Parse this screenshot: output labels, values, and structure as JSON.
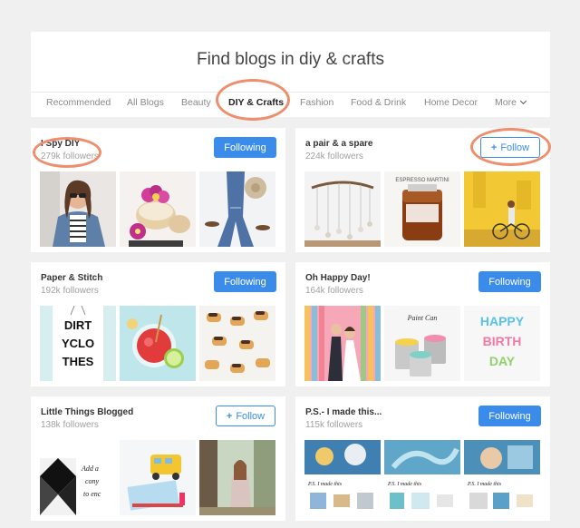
{
  "header": {
    "title": "Find blogs in diy & crafts",
    "tabs": [
      {
        "label": "Recommended"
      },
      {
        "label": "All Blogs"
      },
      {
        "label": "Beauty"
      },
      {
        "label": "DIY & Crafts"
      },
      {
        "label": "Fashion"
      },
      {
        "label": "Food & Drink"
      },
      {
        "label": "Home Decor"
      },
      {
        "label": "More"
      }
    ]
  },
  "blogs": [
    {
      "name": "I Spy DIY",
      "followers": "279k followers",
      "button": "Following"
    },
    {
      "name": "a pair & a spare",
      "followers": "224k followers",
      "button": "Follow"
    },
    {
      "name": "Paper & Stitch",
      "followers": "192k followers",
      "button": "Following"
    },
    {
      "name": "Oh Happy Day!",
      "followers": "164k followers",
      "button": "Following"
    },
    {
      "name": "Little Things Blogged",
      "followers": "138k followers",
      "button": "Follow"
    },
    {
      "name": "P.S.- I made this...",
      "followers": "115k followers",
      "button": "Following"
    }
  ],
  "thumbs": {
    "tshirt": [
      "DIRT",
      "YCLO",
      "THES"
    ],
    "birthday": [
      "HAPPY",
      "BIRTH",
      "DAY"
    ],
    "bottle": "ESPRESSO MARTINI",
    "can": "Paint Can",
    "note": [
      "Add a",
      "cony",
      "to enc"
    ],
    "psTexts": [
      "P.S. I made this",
      "P.S. I made this",
      "P.S. I made this"
    ]
  },
  "colors": {
    "accent": "#3b8cea",
    "highlight": "#ee8e6c"
  }
}
